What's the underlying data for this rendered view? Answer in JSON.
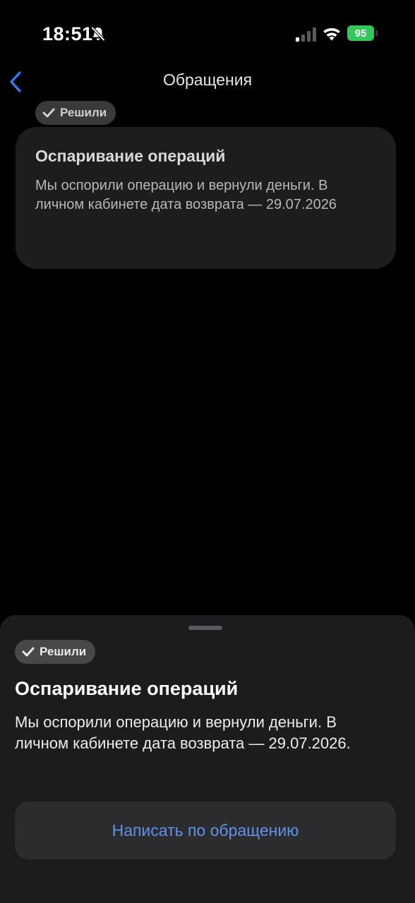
{
  "status_bar": {
    "time": "18:51",
    "battery_level": "95",
    "battery_color": "#34c759",
    "icons": [
      "bell-slash-icon",
      "signal-icon",
      "wifi-icon",
      "battery-charging-icon"
    ]
  },
  "nav": {
    "title": "Обращения",
    "back_icon": "chevron-left-icon",
    "accent_color": "#2e7cf6"
  },
  "card": {
    "title": "Оспаривание операций",
    "text_line1": "Мы оспорили операцию и вернули деньги. В",
    "text_line2": "личном кабинете дата возврата — 29.07.2026",
    "status": "Решили"
  },
  "sheet": {
    "status": "Решили",
    "title": "Оспаривание операций",
    "text_line1": "Мы оспорили операцию и вернули деньги. В",
    "text_line2": "личном кабинете дата возврата — 29.07.2026.",
    "button_label": "Написать по обращению",
    "button_color": "#5e92e8"
  }
}
